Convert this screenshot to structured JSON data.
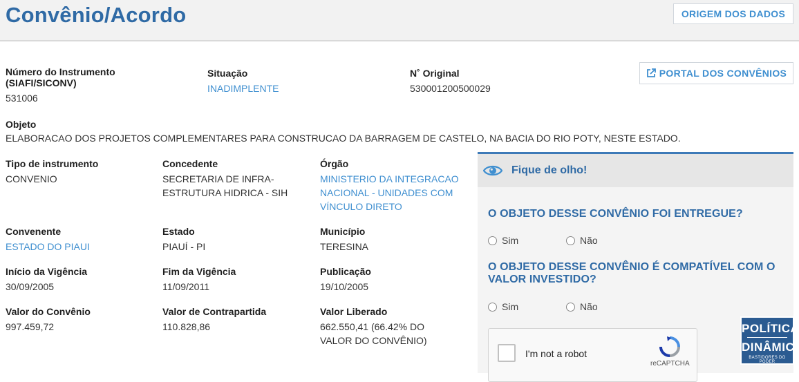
{
  "header": {
    "title": "Convênio/Acordo",
    "origin_button": "ORIGEM DOS DADOS"
  },
  "portal_button": {
    "label": "PORTAL DOS CONVÊNIOS",
    "icon": "external-link-icon"
  },
  "fields": {
    "numero_label": "Número do Instrumento (SIAFI/SICONV)",
    "numero_value": "531006",
    "situacao_label": "Situação",
    "situacao_value": "INADIMPLENTE",
    "original_label": "N˚ Original",
    "original_value": "530001200500029",
    "objeto_label": "Objeto",
    "objeto_value": "ELABORACAO DOS PROJETOS COMPLEMENTARES PARA CONSTRUCAO DA BARRAGEM DE CASTELO, NA BACIA DO RIO POTY, NESTE ESTADO.",
    "tipo_label": "Tipo de instrumento",
    "tipo_value": "CONVENIO",
    "concedente_label": "Concedente",
    "concedente_value": "SECRETARIA DE INFRA-ESTRUTURA HIDRICA - SIH",
    "orgao_label": "Órgão",
    "orgao_value": "MINISTERIO DA INTEGRACAO NACIONAL - UNIDADES COM VÍNCULO DIRETO",
    "convenente_label": "Convenente",
    "convenente_value": "ESTADO DO PIAUI",
    "estado_label": "Estado",
    "estado_value": "PIAUÍ - PI",
    "municipio_label": "Município",
    "municipio_value": "TERESINA",
    "inicio_label": "Início da Vigência",
    "inicio_value": "30/09/2005",
    "fim_label": "Fim da Vigência",
    "fim_value": "11/09/2011",
    "publicacao_label": "Publicação",
    "publicacao_value": "19/10/2005",
    "valor_label": "Valor do Convênio",
    "valor_value": "997.459,72",
    "contrapartida_label": "Valor de Contrapartida",
    "contrapartida_value": "110.828,86",
    "liberado_label": "Valor Liberado",
    "liberado_value": "662.550,41 (66.42% DO VALOR DO CONVÊNIO)"
  },
  "panel": {
    "title": "Fique de olho!",
    "icon": "eye-icon",
    "q1": "O OBJETO DESSE CONVÊNIO FOI ENTREGUE?",
    "q2": "O OBJETO DESSE CONVÊNIO É COMPATÍVEL COM O VALOR INVESTIDO?",
    "yes": "Sim",
    "no": "Não",
    "captcha_text": "I'm not a robot",
    "captcha_brand": "reCAPTCHA"
  },
  "watermark": {
    "line1": "POLÍTICA",
    "line2": "DINÂMICA",
    "line3": "BASTIDORES DO PODER"
  },
  "colors": {
    "accent": "#2f6aa5",
    "link": "#3f8fd0",
    "panel_border": "#3d7ab8"
  }
}
